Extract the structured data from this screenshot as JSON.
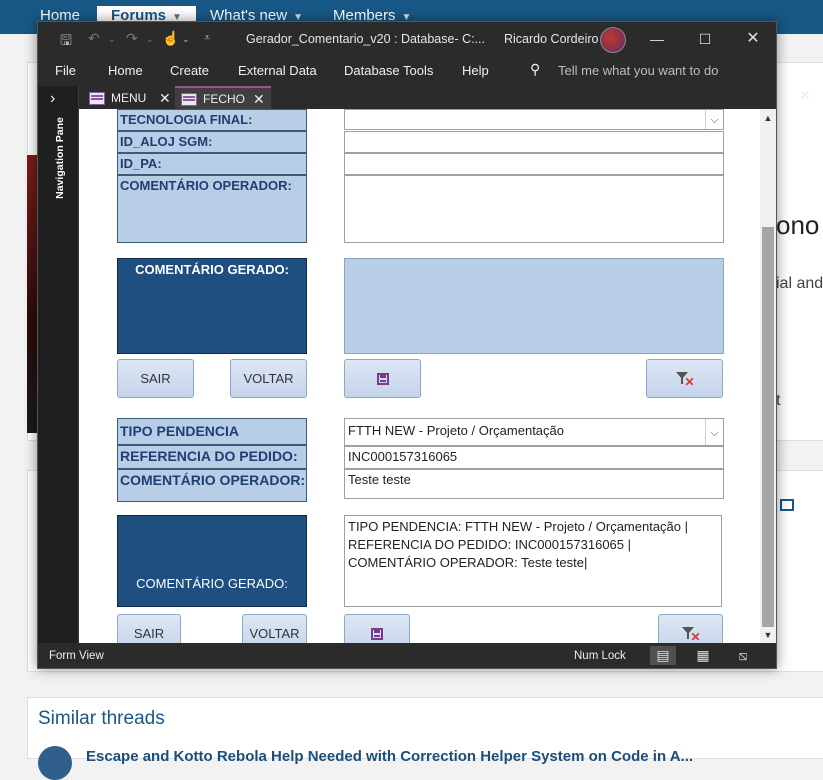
{
  "forum": {
    "nav_tabs": [
      {
        "label": "Home"
      },
      {
        "label": "Forums"
      },
      {
        "label": "What's new"
      },
      {
        "label": "Members"
      }
    ],
    "similar_threads_title": "Similar threads",
    "thread_title": "Escape and Kotto Rebola Help Needed with Correction Helper System on Code in A...",
    "right_fragments": [
      "ono",
      "ial and",
      "t"
    ]
  },
  "window": {
    "title": "Gerador_Comentario_v20 : Database- C:...",
    "user_name": "Ricardo Cordeiro",
    "menu": [
      "File",
      "Home",
      "Create",
      "External Data",
      "Database Tools",
      "Help"
    ],
    "tell_me": "Tell me what you want to do",
    "nav_pane_label": "Navigation Pane",
    "doc_tabs": [
      {
        "label": "MENU",
        "active": false
      },
      {
        "label": "FECHO",
        "active": true
      }
    ],
    "status_left": "Form View",
    "status_numlock": "Num Lock"
  },
  "form": {
    "section1": {
      "labels": [
        "TECNOLOGIA FINAL:",
        "ID_ALOJ SGM:",
        "ID_PA:",
        "COMENTÁRIO OPERADOR:"
      ],
      "generated_label": "COMENTÁRIO GERADO:",
      "generated_value": "",
      "sair": "SAIR",
      "voltar": "VOLTAR"
    },
    "section2": {
      "labels": [
        "TIPO PENDENCIA",
        "REFERENCIA DO PEDIDO:",
        "COMENTÁRIO OPERADOR:"
      ],
      "values": [
        "FTTH NEW - Projeto / Orçamentação",
        "INC000157316065",
        "Teste teste"
      ],
      "generated_label": "COMENTÁRIO GERADO:",
      "generated_value": "TIPO PENDENCIA: FTTH NEW - Projeto / Orçamentação | REFERENCIA DO PEDIDO: INC000157316065 | COMENTÁRIO OPERADOR: Teste teste|",
      "sair": "SAIR",
      "voltar": "VOLTAR"
    }
  },
  "colors": {
    "label_bg": "#b8cde6",
    "label_text": "#1f3f73",
    "dark_box": "#1f4e80",
    "forum_blue": "#185886",
    "access_accent": "#9c4f91"
  }
}
